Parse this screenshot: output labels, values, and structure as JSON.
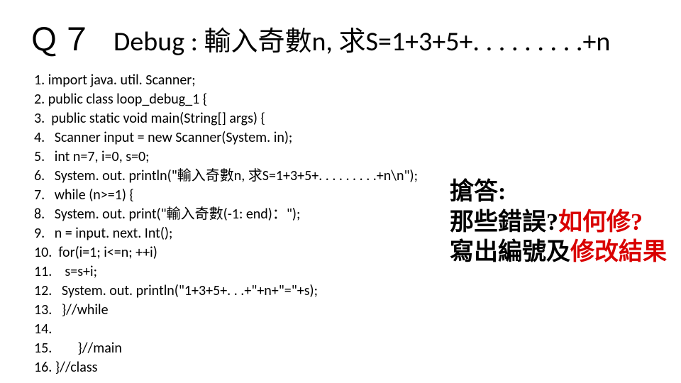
{
  "title": {
    "qnum": "Ｑ７",
    "text": "Debug : 輸入奇數n, 求S=1+3+5+. . . . . . . . .+n"
  },
  "code": [
    "1. import java. util. Scanner;",
    "2. public class loop_debug_1 {",
    "3.  public static void main(String[] args) {",
    "4.   Scanner input = new Scanner(System. in);",
    "5.   int n=7, i=0, s=0;",
    "6.   System. out. println(\"輸入奇數n, 求S=1+3+5+. . . . . . . . .+n\\n\");",
    "7.   while (n>=1) {",
    "8.   System. out. print(\"輸入奇數(-1: end)：\");",
    "9.   n = input. next. Int();",
    "10.  for(i=1; i<=n; ++i)",
    "11.    s=s+i;",
    "12.   System. out. println(\"1+3+5+. . .+\"+n+\"=\"+s);",
    "13.   }//while",
    "14.",
    "15.        }//main",
    "16. }//class"
  ],
  "answer": {
    "line1": "搶答:",
    "line2_black": "那些錯誤?",
    "line2_red": "如何修?",
    "line3_black": "寫出編號及",
    "line3_red": "修改結果"
  }
}
